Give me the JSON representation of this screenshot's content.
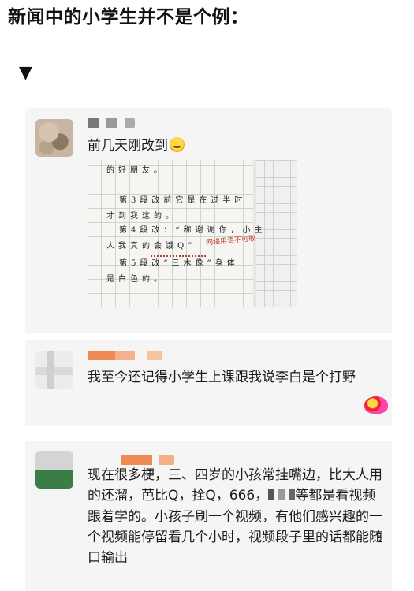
{
  "headline": "新闻中的小学生并不是个例：",
  "arrow": "▼",
  "comments": [
    {
      "text": "前几天刚改到",
      "emoji": "laughing-crying-emoji",
      "photo": {
        "lines": [
          "的好朋友。",
          "第3段改前它是在过半时",
          "才到我这的。",
          "第4段改：“称谢谢你，小主",
          "人我真的会饿Q”",
          "第5段改“三木像”身体",
          "是白色的。"
        ],
        "teacher_note": "网络用语不可取"
      }
    },
    {
      "text": "我至今还记得小学生上课跟我说李白是个打野"
    },
    {
      "text_before": "现在很多梗，三、四岁的小孩常挂嘴边，比大人用的还溜，芭比Q，拴Q，666，",
      "text_after": "等都是看视频跟着学的。小孩子刷一个视频，有他们感兴趣的一个视频能停留看几个小时，视频段子里的话都能随口输出"
    }
  ],
  "colors": {
    "background": "#ffffff",
    "card": "#f5f5f5",
    "text": "#1c1c1c",
    "teacher_ink": "#c0392b"
  }
}
